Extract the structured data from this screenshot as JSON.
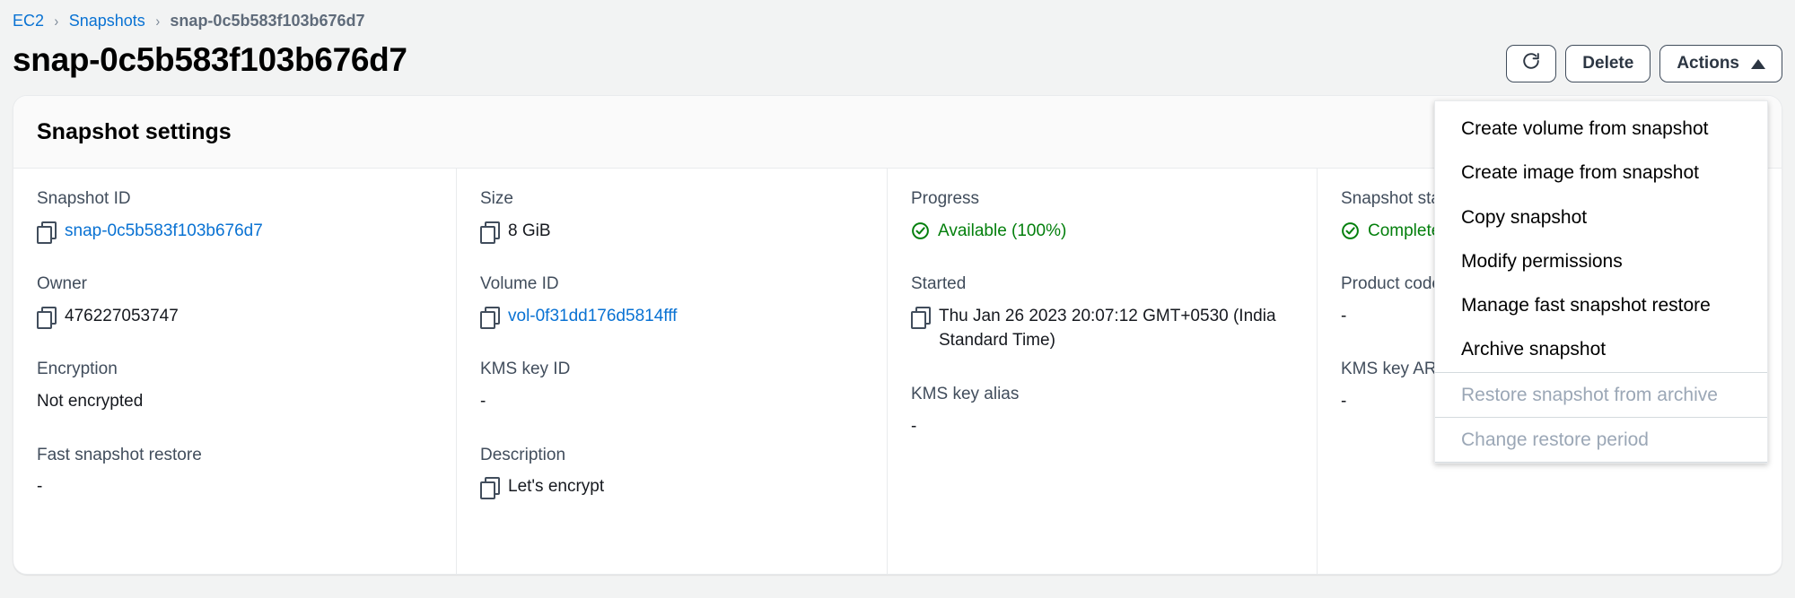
{
  "breadcrumb": {
    "items": [
      {
        "label": "EC2",
        "type": "link"
      },
      {
        "label": "Snapshots",
        "type": "link"
      },
      {
        "label": "snap-0c5b583f103b676d7",
        "type": "current"
      }
    ],
    "separator": "›"
  },
  "header": {
    "title": "snap-0c5b583f103b676d7",
    "refresh_label": "refresh-icon",
    "delete_label": "Delete",
    "actions_label": "Actions"
  },
  "actions_menu": {
    "items": [
      {
        "label": "Create volume from snapshot",
        "disabled": false
      },
      {
        "label": "Create image from snapshot",
        "disabled": false
      },
      {
        "label": "Copy snapshot",
        "disabled": false
      },
      {
        "label": "Modify permissions",
        "disabled": false
      },
      {
        "label": "Manage fast snapshot restore",
        "disabled": false
      },
      {
        "label": "Archive snapshot",
        "disabled": false
      },
      {
        "label": "Restore snapshot from archive",
        "disabled": true
      },
      {
        "label": "Change restore period",
        "disabled": true
      }
    ]
  },
  "panel": {
    "title": "Snapshot settings",
    "columns": [
      {
        "fields": [
          {
            "label": "Snapshot ID",
            "value": "snap-0c5b583f103b676d7",
            "copy": true,
            "link": true
          },
          {
            "label": "Owner",
            "value": "476227053747",
            "copy": true,
            "link": false
          },
          {
            "label": "Encryption",
            "value": "Not encrypted",
            "copy": false,
            "link": false
          },
          {
            "label": "Fast snapshot restore",
            "value": "-",
            "copy": false,
            "link": false
          }
        ]
      },
      {
        "fields": [
          {
            "label": "Size",
            "value": "8 GiB",
            "copy": true,
            "link": false
          },
          {
            "label": "Volume ID",
            "value": "vol-0f31dd176d5814fff",
            "copy": true,
            "link": true
          },
          {
            "label": "KMS key ID",
            "value": "-",
            "copy": false,
            "link": false
          },
          {
            "label": "Description",
            "value": "Let's encrypt",
            "copy": true,
            "link": false
          }
        ]
      },
      {
        "fields": [
          {
            "label": "Progress",
            "value": "Available (100%)",
            "copy": false,
            "link": false,
            "status": "ok"
          },
          {
            "label": "Started",
            "value": "Thu Jan 26 2023 20:07:12 GMT+0530 (India Standard Time)",
            "copy": true,
            "link": false
          },
          {
            "label": "KMS key alias",
            "value": "-",
            "copy": false,
            "link": false
          }
        ]
      },
      {
        "fields": [
          {
            "label": "Snapshot status",
            "value": "Completed",
            "copy": false,
            "link": false,
            "status": "ok"
          },
          {
            "label": "Product codes",
            "value": "-",
            "copy": false,
            "link": false
          },
          {
            "label": "KMS key ARN",
            "value": "-",
            "copy": false,
            "link": false
          }
        ]
      }
    ]
  },
  "colors": {
    "link": "#0972d3",
    "success": "#037f0c",
    "label": "#414d5c",
    "page_bg": "#f2f3f3"
  }
}
